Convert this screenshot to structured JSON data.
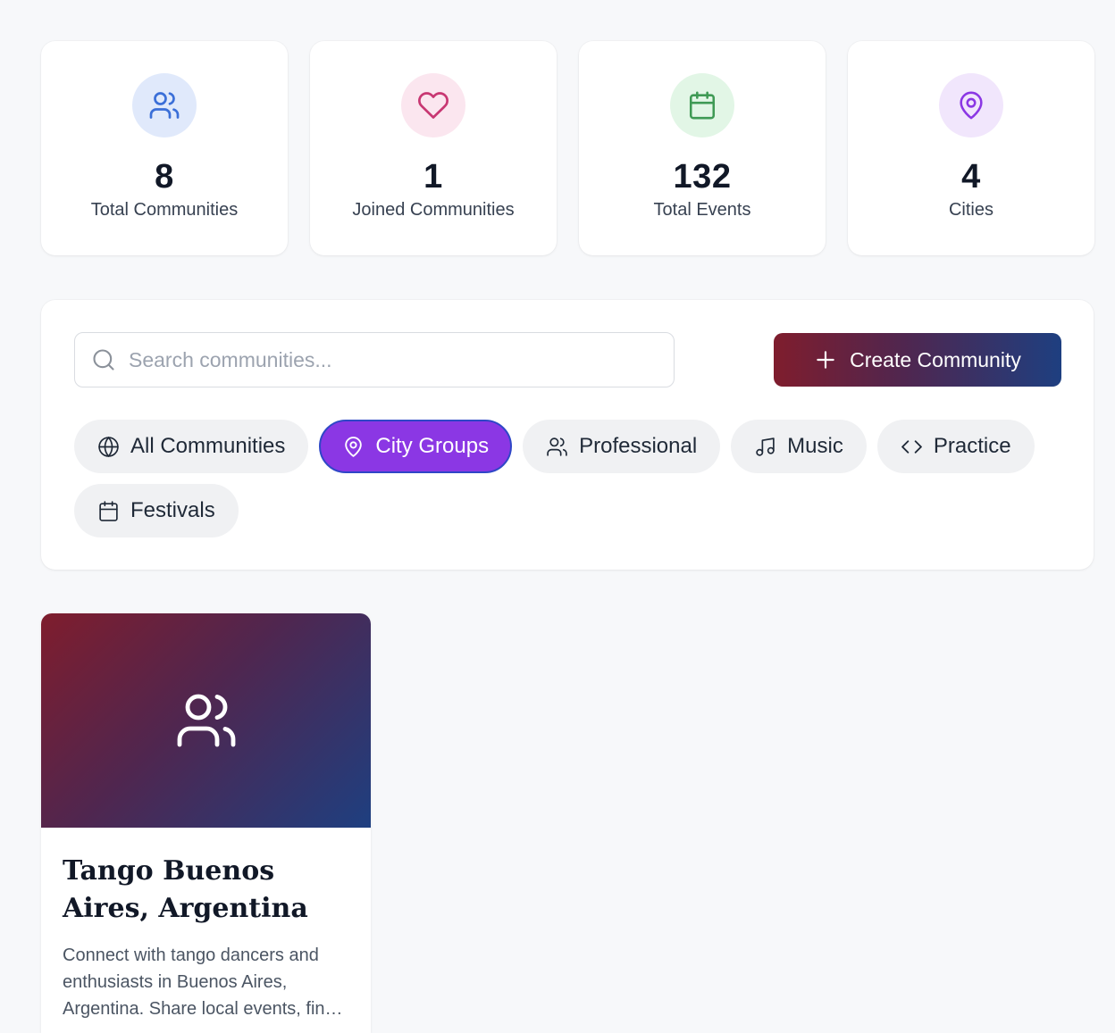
{
  "stats": [
    {
      "value": "8",
      "label": "Total Communities",
      "icon": "users-icon",
      "color": "#3b6fd8",
      "bg": "#e0e9fb"
    },
    {
      "value": "1",
      "label": "Joined Communities",
      "icon": "heart-icon",
      "color": "#c83772",
      "bg": "#fbe6ef"
    },
    {
      "value": "132",
      "label": "Total Events",
      "icon": "calendar-icon",
      "color": "#3f9a55",
      "bg": "#e2f6e6"
    },
    {
      "value": "4",
      "label": "Cities",
      "icon": "map-pin-icon",
      "color": "#8b37e4",
      "bg": "#f1e6fc"
    }
  ],
  "search": {
    "placeholder": "Search communities...",
    "value": ""
  },
  "create_button": {
    "label": "Create Community",
    "icon": "plus-icon"
  },
  "filters": {
    "active": "City Groups",
    "items": [
      {
        "label": "All Communities",
        "icon": "globe-icon"
      },
      {
        "label": "City Groups",
        "icon": "map-pin-icon"
      },
      {
        "label": "Professional",
        "icon": "users-icon"
      },
      {
        "label": "Music",
        "icon": "music-icon"
      },
      {
        "label": "Practice",
        "icon": "code-icon"
      },
      {
        "label": "Festivals",
        "icon": "calendar-icon"
      }
    ]
  },
  "communities": [
    {
      "title": "Tango Buenos Aires, Argentina",
      "description": "Connect with tango dancers and enthusiasts in Buenos Aires, Argentina. Share local events, find practice partners and discover milongas.",
      "icon": "users-icon"
    }
  ],
  "colors": {
    "accent": "#8b37e4",
    "gradient_start": "#7f1d2d",
    "gradient_end": "#1e3f80",
    "page_bg": "#f7f8fa"
  }
}
